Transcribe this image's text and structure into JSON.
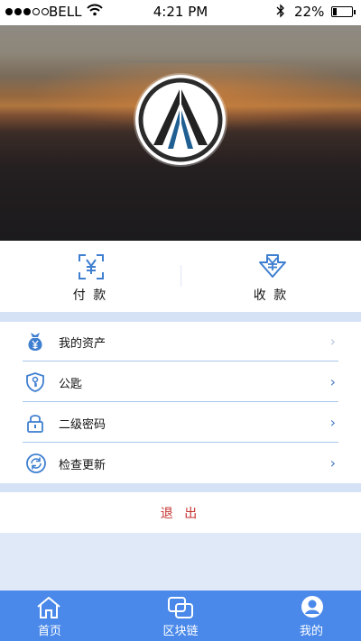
{
  "status_bar": {
    "carrier": "BELL",
    "time": "4:21 PM",
    "battery": "22%",
    "battery_level": 0.22,
    "signal_bars_filled": 3,
    "signal_bars_total": 5
  },
  "header": {
    "logo_icon": "app-logo-icon"
  },
  "actions": {
    "pay_label": "付 款",
    "receive_label": "收 款",
    "pay_icon": "scan-yen-icon",
    "receive_icon": "download-yen-icon"
  },
  "menu": {
    "items": [
      {
        "label": "我的资产",
        "icon": "money-bag-icon"
      },
      {
        "label": "公匙",
        "icon": "shield-key-icon"
      },
      {
        "label": "二级密码",
        "icon": "padlock-icon"
      },
      {
        "label": "检查更新",
        "icon": "refresh-icon"
      }
    ]
  },
  "logout_label": "退 出",
  "tabbar": {
    "tabs": [
      {
        "label": "首页",
        "icon": "home-icon"
      },
      {
        "label": "区块链",
        "icon": "blockchain-icon"
      },
      {
        "label": "我的",
        "icon": "user-icon"
      }
    ]
  },
  "colors": {
    "accent": "#4a89ea",
    "logout": "#c4322f",
    "band": "#d5e2f6"
  }
}
